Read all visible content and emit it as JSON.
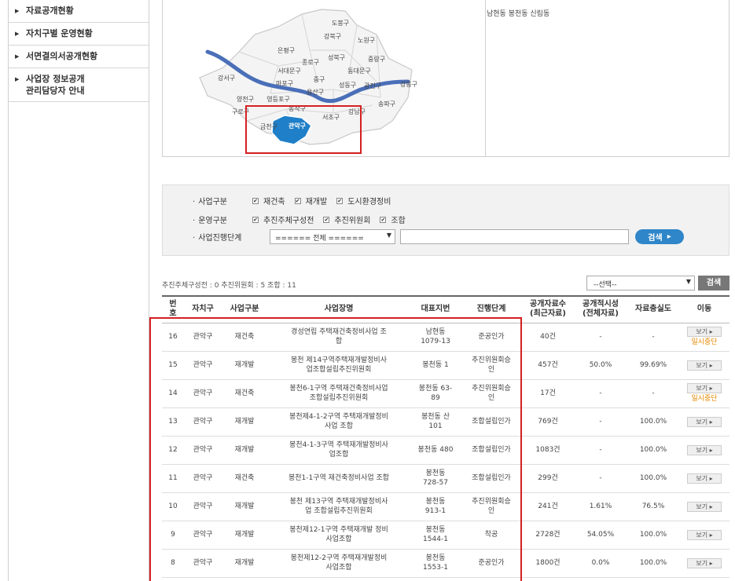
{
  "sidebar": {
    "items": [
      {
        "label": "자료공개현황"
      },
      {
        "label": "자치구별 운영현황"
      },
      {
        "label": "서면결의서공개현황"
      },
      {
        "label": "사업장 정보공개\n관리담당자 안내"
      }
    ]
  },
  "map": {
    "districts": [
      "도봉구",
      "강북구",
      "노원구",
      "은평구",
      "성북구",
      "중랑구",
      "종로구",
      "서대문구",
      "동대문구",
      "마포구",
      "중구",
      "성동구",
      "광진구",
      "강동구",
      "강서구",
      "용산구",
      "송파구",
      "양천구",
      "영등포구",
      "동작구",
      "강남구",
      "구로구",
      "서초구",
      "금천구",
      "관악구"
    ],
    "selected": "관악구",
    "highlight_color": "#1f7fc8",
    "river_color": "#4a6fb8"
  },
  "dongs": "남현동 봉천동 신림동",
  "search": {
    "row1": {
      "label": "사업구분",
      "options": [
        "재건축",
        "재개발",
        "도시환경정비"
      ]
    },
    "row2": {
      "label": "운영구분",
      "options": [
        "추진주체구성전",
        "추진위원회",
        "조합"
      ]
    },
    "row3": {
      "label": "사업진행단계",
      "select": "====== 전체 ======",
      "button": "검색"
    }
  },
  "summary": "추진주체구성전 : 0   추진위원회 : 5   조합 : 11",
  "filter": {
    "select": "--선택--",
    "button": "검색"
  },
  "table": {
    "headers": [
      "번\n호",
      "자치구",
      "사업구분",
      "사업장명",
      "대표지번",
      "진행단계",
      "공개자료수\n(최근자료)",
      "공개적시성\n(전체자료)",
      "자료충실도",
      "이동"
    ],
    "view_label": "보기 ▸",
    "suspend_label": "일시중단",
    "rows": [
      {
        "no": "16",
        "gu": "관악구",
        "type": "재건축",
        "name": "경성연립 주택재건축정비사업 조\n합",
        "lot": "남현동\n1079-13",
        "stage": "준공인가",
        "count": "40건",
        "timely": "-",
        "fidelity": "-",
        "suspend": true
      },
      {
        "no": "15",
        "gu": "관악구",
        "type": "재개발",
        "name": "봉천 제14구역주택재개발정비사\n업조합설립추진위원회",
        "lot": "봉천동 1",
        "stage": "추진위원회승\n인",
        "count": "457건",
        "timely": "50.0%",
        "fidelity": "99.69%",
        "suspend": false
      },
      {
        "no": "14",
        "gu": "관악구",
        "type": "재건축",
        "name": "봉천6-1구역 주택재건축정비사업\n조합설립추진위원회",
        "lot": "봉천동 63-\n89",
        "stage": "추진위원회승\n인",
        "count": "17건",
        "timely": "-",
        "fidelity": "-",
        "suspend": true
      },
      {
        "no": "13",
        "gu": "관악구",
        "type": "재개발",
        "name": "봉천제4-1-2구역 주택재개발정비\n사업 조합",
        "lot": "봉천동 산\n101",
        "stage": "조합설립인가",
        "count": "769건",
        "timely": "-",
        "fidelity": "100.0%",
        "suspend": false
      },
      {
        "no": "12",
        "gu": "관악구",
        "type": "재개발",
        "name": "봉천4-1-3구역 주택재개발정비사\n업조합",
        "lot": "봉천동 480",
        "stage": "조합설립인가",
        "count": "1083건",
        "timely": "-",
        "fidelity": "100.0%",
        "suspend": false
      },
      {
        "no": "11",
        "gu": "관악구",
        "type": "재건축",
        "name": "봉천1-1구역 재건축정비사업 조합",
        "lot": "봉천동\n728-57",
        "stage": "조합설립인가",
        "count": "299건",
        "timely": "-",
        "fidelity": "100.0%",
        "suspend": false
      },
      {
        "no": "10",
        "gu": "관악구",
        "type": "재개발",
        "name": "봉천 제13구역 주택재개발정비사\n업 조합설립추진위원회",
        "lot": "봉천동\n913-1",
        "stage": "추진위원회승\n인",
        "count": "241건",
        "timely": "1.61%",
        "fidelity": "76.5%",
        "suspend": false
      },
      {
        "no": "9",
        "gu": "관악구",
        "type": "재개발",
        "name": "봉천제12-1구역 주택재개발 정비\n사업조합",
        "lot": "봉천동\n1544-1",
        "stage": "착공",
        "count": "2728건",
        "timely": "54.05%",
        "fidelity": "100.0%",
        "suspend": false
      },
      {
        "no": "8",
        "gu": "관악구",
        "type": "재개발",
        "name": "봉천제12-2구역 주택재개발정비\n사업조합",
        "lot": "봉천동\n1553-1",
        "stage": "준공인가",
        "count": "1800건",
        "timely": "0.0%",
        "fidelity": "100.0%",
        "suspend": false
      }
    ]
  }
}
